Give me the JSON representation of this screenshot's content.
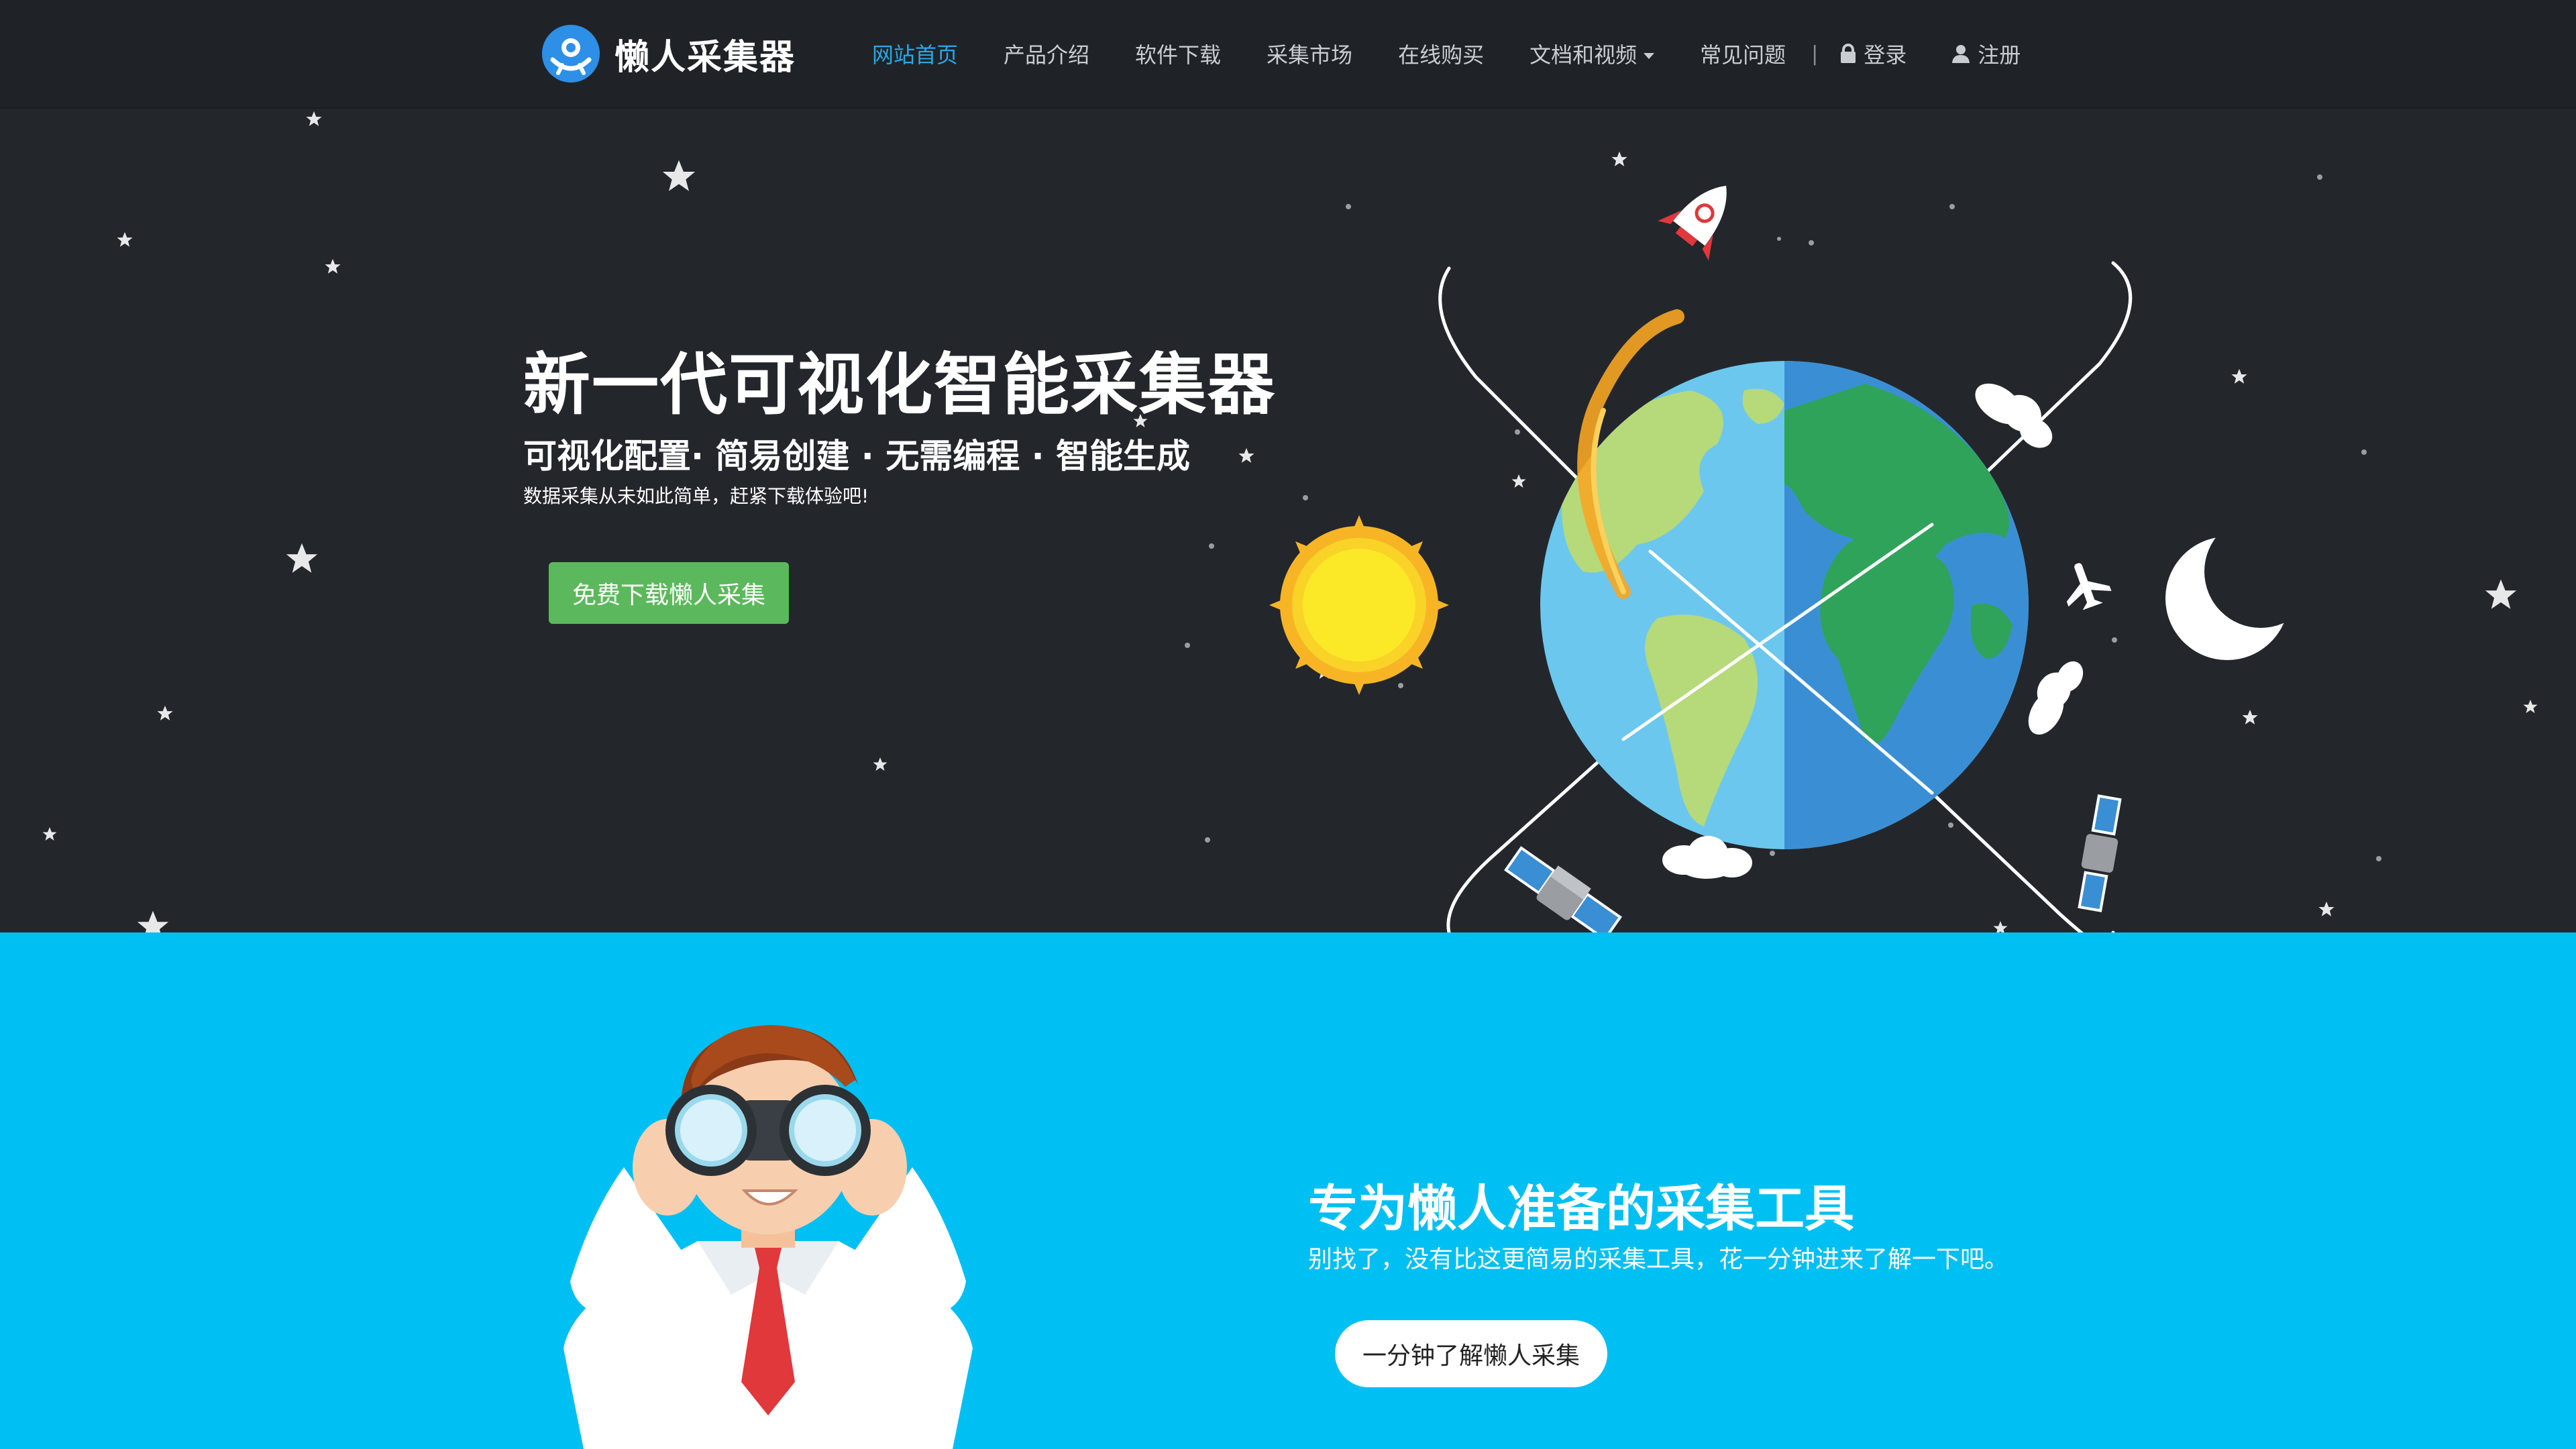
{
  "brand": {
    "name": "懒人采集器"
  },
  "nav": {
    "items": [
      {
        "label": "网站首页",
        "active": true
      },
      {
        "label": "产品介绍",
        "active": false
      },
      {
        "label": "软件下载",
        "active": false
      },
      {
        "label": "采集市场",
        "active": false
      },
      {
        "label": "在线购买",
        "active": false
      },
      {
        "label": "文档和视频",
        "active": false,
        "dropdown": true
      },
      {
        "label": "常见问题",
        "active": false
      }
    ],
    "separator": "|",
    "login": "登录",
    "register": "注册"
  },
  "hero": {
    "title": "新一代可视化智能采集器",
    "subtitle": "可视化配置· 简易创建 · 无需编程 · 智能生成",
    "tagline": "数据采集从未如此简单，赶紧下载体验吧!",
    "cta": "免费下载懒人采集"
  },
  "intro": {
    "title": "专为懒人准备的采集工具",
    "subtitle": "别找了，没有比这更简易的采集工具，花一分钟进来了解一下吧。",
    "cta": "一分钟了解懒人采集"
  },
  "colors": {
    "nav_bg": "#1f2327",
    "nav_active": "#29a8e8",
    "hero_bg": "#23272c",
    "download_btn": "#5cb85c",
    "section2_bg": "#00bff2"
  },
  "icons": [
    "lock-icon",
    "user-icon",
    "rocket-icon",
    "sun-icon",
    "moon-icon",
    "earth-icon",
    "satellite-icon",
    "cloud-icon",
    "airplane-icon",
    "star-icon"
  ]
}
